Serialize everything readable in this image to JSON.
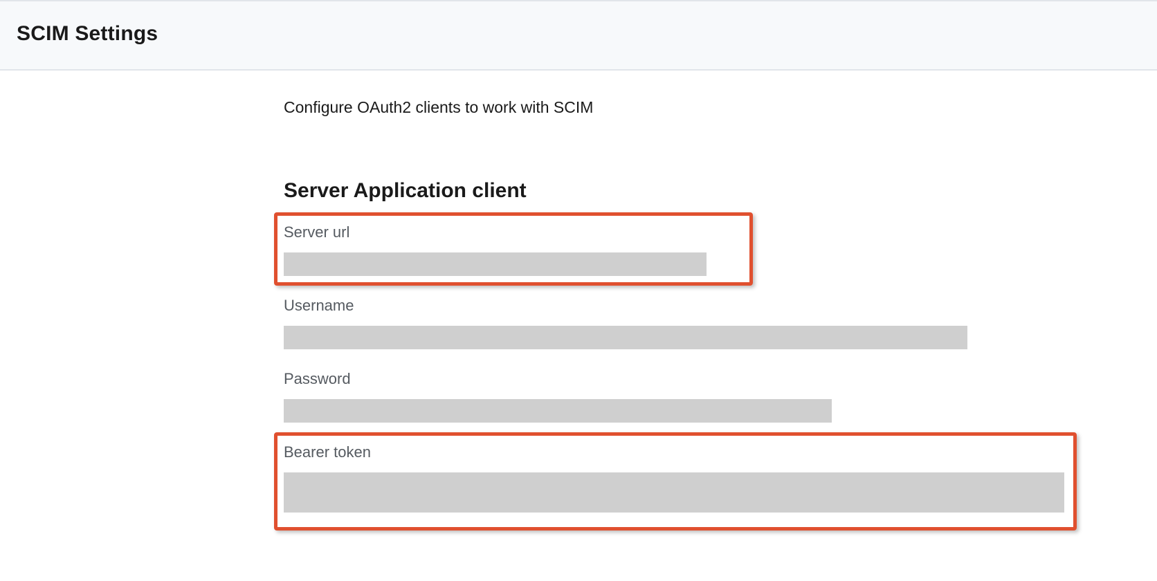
{
  "header": {
    "title": "SCIM Settings"
  },
  "main": {
    "subtitle": "Configure OAuth2 clients to work with SCIM",
    "section": {
      "heading": "Server Application client",
      "fields": {
        "server_url": {
          "label": "Server url",
          "value": ""
        },
        "username": {
          "label": "Username",
          "value": ""
        },
        "password": {
          "label": "Password",
          "value": ""
        },
        "bearer": {
          "label": "Bearer token",
          "value": ""
        }
      }
    }
  },
  "annotation": {
    "highlight_color": "#e0502f"
  }
}
